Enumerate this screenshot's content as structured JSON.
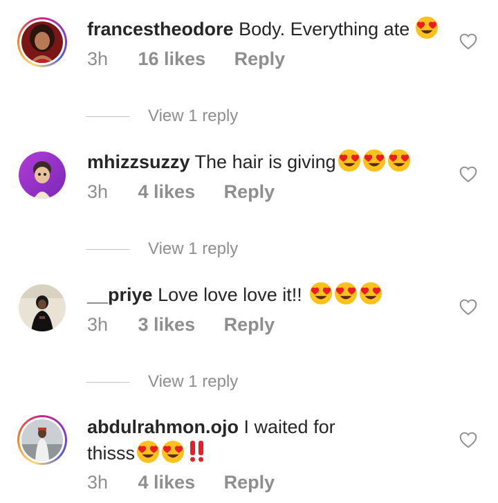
{
  "comments": [
    {
      "username": "francestheodore",
      "text": "Body. Everything ate",
      "emoji_suffix": [
        "smiling-face-with-heart-eyes"
      ],
      "time": "3h",
      "likes": "16 likes",
      "reply_label": "Reply",
      "view_replies": "View 1 reply",
      "has_story_ring": true
    },
    {
      "username": "mhizzsuzzy",
      "text": "The hair is giving",
      "emoji_suffix": [
        "smiling-face-with-heart-eyes",
        "smiling-face-with-heart-eyes",
        "smiling-face-with-heart-eyes"
      ],
      "time": "3h",
      "likes": "4 likes",
      "reply_label": "Reply",
      "view_replies": "View 1 reply",
      "has_story_ring": false
    },
    {
      "username": "__priye",
      "text": "Love love love it!!",
      "emoji_suffix": [
        "smiling-face-with-heart-eyes",
        "smiling-face-with-heart-eyes",
        "smiling-face-with-heart-eyes"
      ],
      "time": "3h",
      "likes": "3 likes",
      "reply_label": "Reply",
      "view_replies": "View 1 reply",
      "has_story_ring": false
    },
    {
      "username": "abdulrahmon.ojo",
      "text": "I waited for thisss",
      "emoji_suffix": [
        "smiling-face-with-heart-eyes",
        "smiling-face-with-heart-eyes",
        "double-exclamation-mark"
      ],
      "time": "3h",
      "likes": "4 likes",
      "reply_label": "Reply",
      "has_story_ring": true
    }
  ],
  "colors": {
    "primary_text": "#262626",
    "secondary_text": "#8e8e8e",
    "divider": "#c7c7c7"
  }
}
